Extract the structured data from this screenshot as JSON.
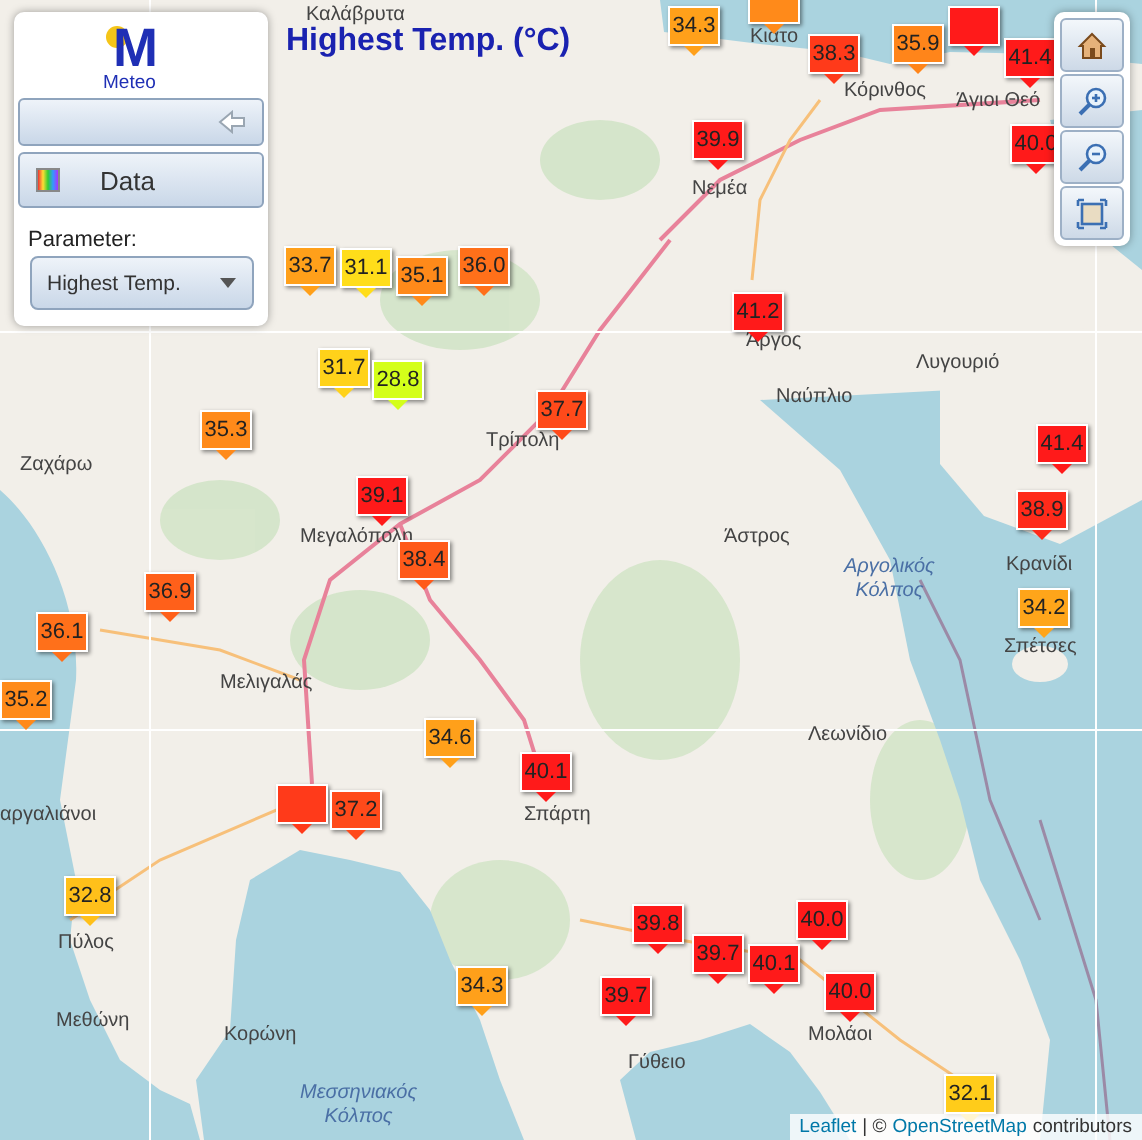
{
  "panel": {
    "logo_mark": "M",
    "logo_text": "Meteo",
    "data_button": "Data",
    "parameter_label": "Parameter:",
    "parameter_select": "Highest Temp."
  },
  "title": "Highest Temp. (°C)",
  "map_controls": [
    {
      "kind": "home"
    },
    {
      "kind": "zoom-in"
    },
    {
      "kind": "zoom-out"
    },
    {
      "kind": "extent"
    }
  ],
  "place_labels": [
    {
      "text": "Καλάβρυτα",
      "kind": "town"
    },
    {
      "text": "Κιάτο",
      "kind": "town"
    },
    {
      "text": "Κόρινθος",
      "kind": "town"
    },
    {
      "text": "Άγιοι Θεό",
      "kind": "town"
    },
    {
      "text": "Νεμέα",
      "kind": "town"
    },
    {
      "text": "Λυγουριό",
      "kind": "town"
    },
    {
      "text": "Άργος",
      "kind": "town"
    },
    {
      "text": "Ναύπλιο",
      "kind": "town"
    },
    {
      "text": "Τρίπολη",
      "kind": "town"
    },
    {
      "text": "Ζαχάρω",
      "kind": "town"
    },
    {
      "text": "Μεγαλόπολη",
      "kind": "town"
    },
    {
      "text": "Άστρος",
      "kind": "town"
    },
    {
      "text": "Αργολικός\nΚόλπος",
      "kind": "sea"
    },
    {
      "text": "Κρανίδι",
      "kind": "town"
    },
    {
      "text": "Σπέτσες",
      "kind": "town"
    },
    {
      "text": "Μελιγαλάς",
      "kind": "town"
    },
    {
      "text": "Λεωνίδιο",
      "kind": "town"
    },
    {
      "text": "αργαλιάνοι",
      "kind": "town"
    },
    {
      "text": "Σπάρτη",
      "kind": "town"
    },
    {
      "text": "Πύλος",
      "kind": "town"
    },
    {
      "text": "Μεθώνη",
      "kind": "town"
    },
    {
      "text": "Κορώνη",
      "kind": "town"
    },
    {
      "text": "Μεσσηνιακός\nΚόλπος",
      "kind": "sea"
    },
    {
      "text": "Γύθειο",
      "kind": "town"
    },
    {
      "text": "Μολάοι",
      "kind": "town"
    }
  ],
  "markers": [
    {
      "color": "#ff8a1a"
    },
    {
      "value": "33.7",
      "color": "#ffa01a"
    },
    {
      "value": "31.1",
      "color": "#ffdd1a"
    },
    {
      "value": "35.1",
      "color": "#ff8a1a"
    },
    {
      "value": "36.0",
      "color": "#ff701a"
    },
    {
      "value": "31.7",
      "color": "#ffd21a"
    },
    {
      "value": "28.8",
      "color": "#d4ff1a"
    },
    {
      "value": "34.3",
      "color": "#ffa01a"
    },
    {
      "value": "38.3",
      "color": "#ff3a1a"
    },
    {
      "color": "#ff1a1a"
    },
    {
      "value": "35.9",
      "color": "#ff851a"
    },
    {
      "value": "41.4",
      "color": "#ff1a1a"
    },
    {
      "value": "40.0",
      "color": "#ff1a1a"
    },
    {
      "value": "39.9",
      "color": "#ff1a1a"
    },
    {
      "value": "41.2",
      "color": "#ff1a1a"
    },
    {
      "value": "37.7",
      "color": "#ff4a1a"
    },
    {
      "value": "35.3",
      "color": "#ff8a1a"
    },
    {
      "value": "39.1",
      "color": "#ff1a1a"
    },
    {
      "value": "38.4",
      "color": "#ff5a1a"
    },
    {
      "value": "36.9",
      "color": "#ff601a"
    },
    {
      "value": "36.1",
      "color": "#ff701a"
    },
    {
      "value": "35.2",
      "color": "#ff8a1a"
    },
    {
      "value": "34.6",
      "color": "#ffa01a"
    },
    {
      "value": "40.1",
      "color": "#ff1a1a"
    },
    {
      "color": "#ff3a1a"
    },
    {
      "value": "37.2",
      "color": "#ff4a1a"
    },
    {
      "value": "41.4",
      "color": "#ff1a1a"
    },
    {
      "value": "38.9",
      "color": "#ff2a1a"
    },
    {
      "value": "34.2",
      "color": "#ffa51a"
    },
    {
      "value": "32.8",
      "color": "#ffc01a"
    },
    {
      "value": "34.3",
      "color": "#ffa01a"
    },
    {
      "value": "39.8",
      "color": "#ff1a1a"
    },
    {
      "value": "39.7",
      "color": "#ff1a1a"
    },
    {
      "value": "40.1",
      "color": "#ff1a1a"
    },
    {
      "value": "40.0",
      "color": "#ff1a1a"
    },
    {
      "value": "39.7",
      "color": "#ff1a1a"
    },
    {
      "value": "40.0",
      "color": "#ff1a1a"
    },
    {
      "value": "32.1",
      "color": "#ffcc1a"
    }
  ],
  "attribution": {
    "leaflet_link": "Leaflet",
    "separator": "| ©",
    "osm_link": "OpenStreetMap",
    "suffix": "contributors"
  }
}
